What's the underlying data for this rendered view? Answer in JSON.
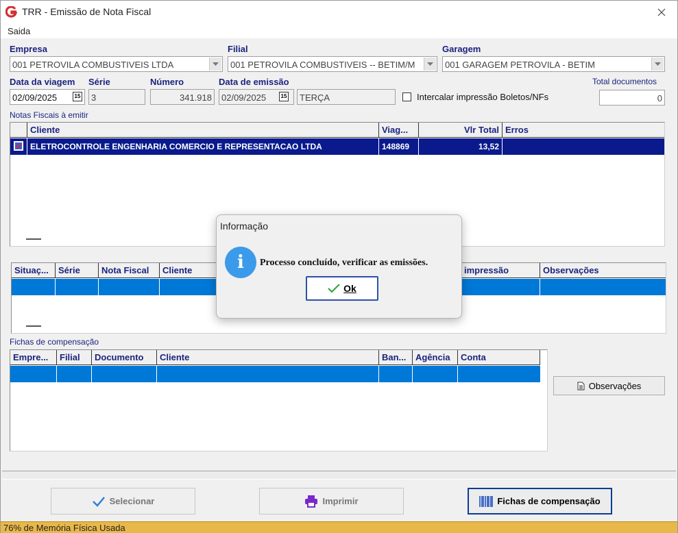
{
  "window": {
    "title": "TRR - Emissão de Nota Fiscal"
  },
  "menu": {
    "saida": "Saida"
  },
  "header": {
    "empresa_label": "Empresa",
    "empresa_value": "001 PETROVILA COMBUSTIVEIS LTDA",
    "filial_label": "Filial",
    "filial_value": "001 PETROVILA COMBUSTIVEIS -- BETIM/M",
    "garagem_label": "Garagem",
    "garagem_value": "001 GARAGEM PETROVILA - BETIM",
    "data_viagem_label": "Data da viagem",
    "data_viagem_value": "02/09/2025",
    "serie_label": "Série",
    "serie_value": "3",
    "numero_label": "Número",
    "numero_value": "341.918",
    "data_emissao_label": "Data de emissão",
    "data_emissao_value": "02/09/2025",
    "dia_semana": "TERÇA",
    "intercalar_label": "Intercalar impressão Boletos/NFs",
    "total_docs_label": "Total documentos",
    "total_docs_value": "0",
    "calendar_glyph": "15"
  },
  "notas": {
    "label": "Notas Fiscais à emitir",
    "columns": [
      "Cliente",
      "Viag...",
      "Vlr Total",
      "Erros"
    ],
    "rows": [
      {
        "cliente": "ELETROCONTROLE ENGENHARIA COMERCIO E REPRESENTACAO LTDA",
        "viagem": "148869",
        "vlr_total": "13,52",
        "erros": ""
      }
    ]
  },
  "emissoes": {
    "columns": [
      "Situaç...",
      "Série",
      "Nota Fiscal",
      "Cliente",
      "impressão",
      "Observações"
    ]
  },
  "fichas": {
    "label": "Fichas de compensação",
    "columns": [
      "Empre...",
      "Filial",
      "Documento",
      "Cliente",
      "Ban...",
      "Agência",
      "Conta"
    ],
    "observacoes_button": "Observações"
  },
  "footer": {
    "selecionar": "Selecionar",
    "imprimir": "Imprimir",
    "fichas": "Fichas de compensação"
  },
  "status": {
    "text": "76% de Memória Física Usada"
  },
  "dialog": {
    "title": "Informação",
    "message": "Processo concluído, verificar as emissões.",
    "ok": "Ok",
    "icon_letter": "i"
  }
}
